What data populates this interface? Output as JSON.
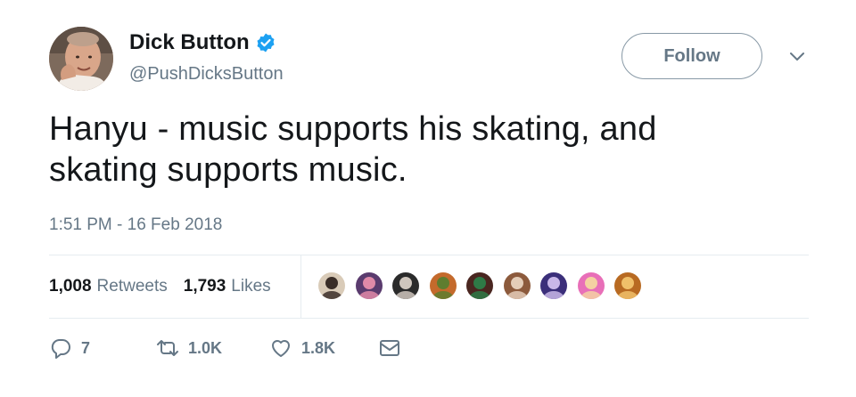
{
  "user": {
    "display_name": "Dick Button",
    "handle": "@PushDicksButton",
    "verified": true
  },
  "follow_label": "Follow",
  "tweet": {
    "text_line1": "Hanyu - music supports his skating, and",
    "text_line2": "skating supports music.",
    "timestamp": "1:51 PM - 16 Feb 2018"
  },
  "stats": {
    "retweets_count": "1,008",
    "retweets_label": "Retweets",
    "likes_count": "1,793",
    "likes_label": "Likes"
  },
  "likers": [
    {
      "bg": "#d9cbb8",
      "fg": "#3a2e28"
    },
    {
      "bg": "#5a3b6e",
      "fg": "#e08aa8"
    },
    {
      "bg": "#2b2b2b",
      "fg": "#cfc6bd"
    },
    {
      "bg": "#c46a2c",
      "fg": "#5e7d2f"
    },
    {
      "bg": "#4a2620",
      "fg": "#2e7a46"
    },
    {
      "bg": "#8c5a3c",
      "fg": "#e4cdb8"
    },
    {
      "bg": "#3b2f7a",
      "fg": "#c9b7e8"
    },
    {
      "bg": "#e86fb8",
      "fg": "#f4d1a2"
    },
    {
      "bg": "#b86a22",
      "fg": "#f0c06a"
    }
  ],
  "actions": {
    "reply_count": "7",
    "retweet_count": "1.0K",
    "like_count": "1.8K"
  },
  "colors": {
    "verified_blue": "#1da1f2",
    "secondary_text": "#657786",
    "primary_text": "#14171a",
    "border": "#e6ecf0"
  },
  "icons": [
    "verified-badge-icon",
    "chevron-down-icon",
    "reply-icon",
    "retweet-icon",
    "heart-icon",
    "message-icon"
  ]
}
